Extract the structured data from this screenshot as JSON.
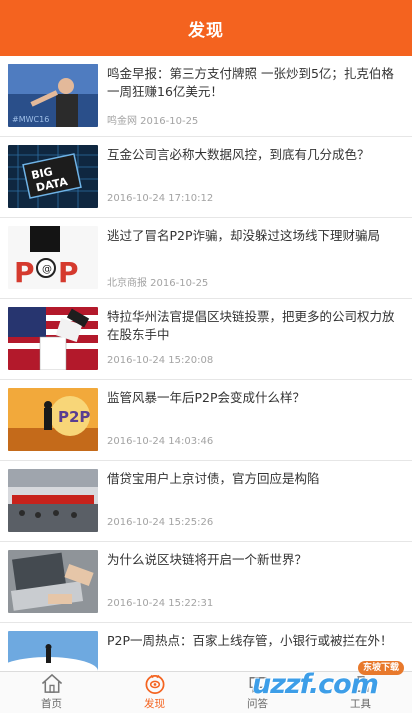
{
  "header": {
    "title": "发现"
  },
  "articles": [
    {
      "title": "鸣金早报：第三方支付牌照 一张炒到5亿；扎克伯格一周狂赚16亿美元！",
      "meta": "鸣金网 2016-10-25",
      "thumb": "person-on-stage"
    },
    {
      "title": "互金公司言必称大数据风控，到底有几分成色？",
      "meta": "2016-10-24 17:10:12",
      "thumb": "big-data-chip"
    },
    {
      "title": "逃过了冒名P2P诈骗，却没躲过这场线下理财骗局",
      "meta": "北京商报 2016-10-25",
      "thumb": "p2p-hand"
    },
    {
      "title": "特拉华州法官提倡区块链投票，把更多的公司权力放在股东手中",
      "meta": "2016-10-24 15:20:08",
      "thumb": "ballot-flag"
    },
    {
      "title": "监管风暴一年后P2P会变成什么样？",
      "meta": "2016-10-24 14:03:46",
      "thumb": "p2p-figure"
    },
    {
      "title": "借贷宝用户上京讨债，官方回应是构陷",
      "meta": "2016-10-24 15:25:26",
      "thumb": "street-banner"
    },
    {
      "title": "为什么说区块链将开启一个新世界？",
      "meta": "2016-10-24 15:22:31",
      "thumb": "laptop-hands"
    },
    {
      "title": "P2P一周热点：百家上线存管，小银行或被拦在外！",
      "meta": "",
      "thumb": "sky-figure"
    }
  ],
  "tabbar": [
    {
      "label": "首页",
      "icon": "home-icon",
      "active": false
    },
    {
      "label": "发现",
      "icon": "discover-icon",
      "active": true
    },
    {
      "label": "问答",
      "icon": "qa-icon",
      "active": false
    },
    {
      "label": "工具",
      "icon": "tools-icon",
      "active": false
    }
  ],
  "watermark": {
    "badge": "东坡下载",
    "text": "uzzf.com"
  },
  "colors": {
    "accent": "#f4631f",
    "meta_text": "#a3a3a3",
    "title_text": "#333333"
  }
}
